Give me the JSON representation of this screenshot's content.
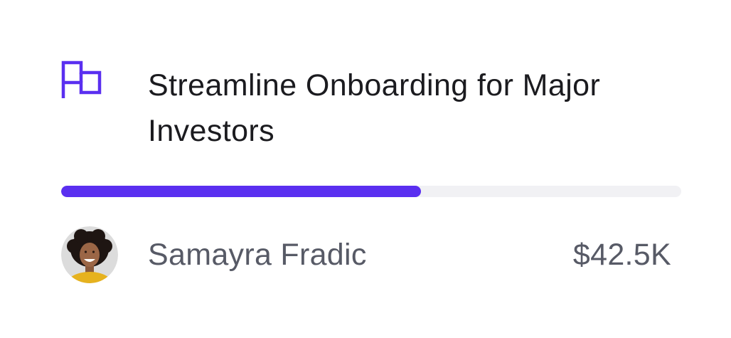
{
  "card": {
    "title": "Streamline Onboarding for Major Investors",
    "icon": "flag-icon",
    "accent_color": "#5a2ff0",
    "progress": {
      "fraction": 0.58,
      "track_color": "#f1f1f4"
    },
    "owner": {
      "name": "Samayra Fradic",
      "avatar": "avatar-photo"
    },
    "amount": "$42.5K"
  }
}
